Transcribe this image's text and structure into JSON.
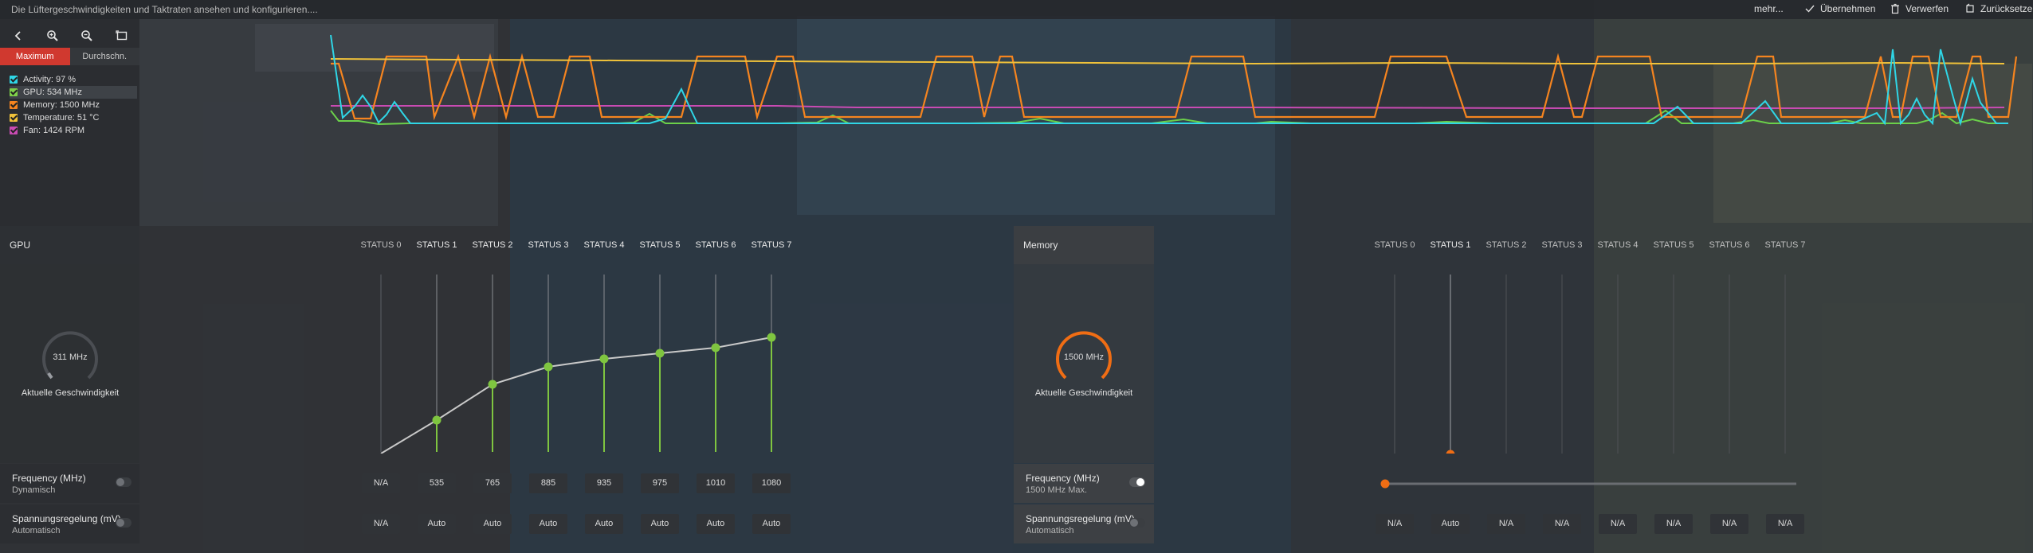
{
  "topbar": {
    "hint": "Die Lüftergeschwindigkeiten und Taktraten ansehen und konfigurieren....",
    "more": "mehr...",
    "apply": "Übernehmen",
    "discard": "Verwerfen",
    "reset": "Zurücksetzen"
  },
  "graph_controls": {
    "tools": [
      "back-icon",
      "zoom-in-icon",
      "zoom-out-icon",
      "fit-icon"
    ],
    "mode_max": "Maximum",
    "mode_avg": "Durchschn."
  },
  "legend": [
    {
      "label": "Activity: 97 %",
      "color": "#2fd6e6"
    },
    {
      "label": "GPU: 534 MHz",
      "color": "#7fd24a"
    },
    {
      "label": "Memory: 1500 MHz",
      "color": "#f5841f"
    },
    {
      "label": "Temperature: 51 °C",
      "color": "#f0c23a"
    },
    {
      "label": "Fan: 1424 RPM",
      "color": "#c94bb3"
    }
  ],
  "gpu": {
    "title": "GPU",
    "states": [
      "STATUS 0",
      "STATUS 1",
      "STATUS 2",
      "STATUS 3",
      "STATUS 4",
      "STATUS 5",
      "STATUS 6",
      "STATUS 7"
    ],
    "gauge_value": "311 MHz",
    "gauge_label": "Aktuelle Geschwindigkeit",
    "frequency_label": "Frequency (MHz)",
    "frequency_mode": "Dynamisch",
    "frequencies": [
      "N/A",
      "535",
      "765",
      "885",
      "935",
      "975",
      "1010",
      "1080"
    ],
    "voltage_label": "Spannungsregelung (mV)",
    "voltage_mode": "Automatisch",
    "voltages": [
      "N/A",
      "Auto",
      "Auto",
      "Auto",
      "Auto",
      "Auto",
      "Auto",
      "Auto"
    ]
  },
  "memory": {
    "title": "Memory",
    "states": [
      "STATUS 0",
      "STATUS 1",
      "STATUS 2",
      "STATUS 3",
      "STATUS 4",
      "STATUS 5",
      "STATUS 6",
      "STATUS 7"
    ],
    "gauge_value": "1500 MHz",
    "gauge_label": "Aktuelle Geschwindigkeit",
    "frequency_label": "Frequency (MHz)",
    "frequency_mode": "1500 MHz Max.",
    "voltage_label": "Spannungsregelung (mV)",
    "voltage_mode": "Automatisch",
    "voltages": [
      "N/A",
      "Auto",
      "N/A",
      "N/A",
      "N/A",
      "N/A",
      "N/A",
      "N/A"
    ]
  },
  "colors": {
    "accent_red": "#d0392f",
    "gpu_green": "#7fc540",
    "memory_orange": "#f06d14"
  }
}
